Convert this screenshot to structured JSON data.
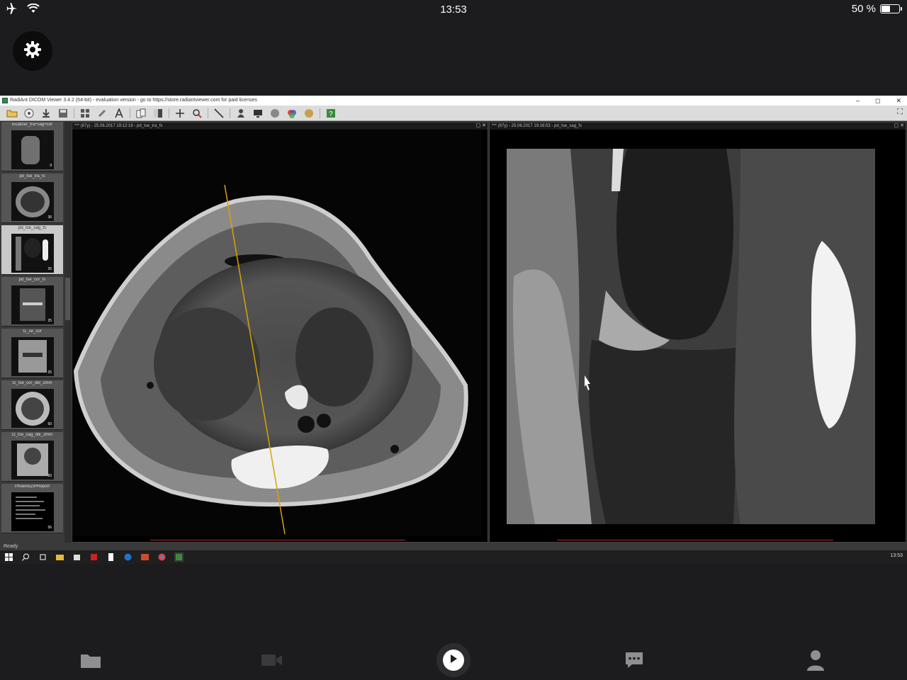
{
  "status_bar": {
    "time": "13:53",
    "battery_text": "50 %",
    "battery_level": 0.5
  },
  "remote": {
    "window_title": "RadiAnt DICOM Viewer 3.4.2 (64-bit) - evaluation version - go to https://store.radiantviewer.com for paid licenses",
    "window_controls": [
      "–",
      "◻",
      "✕"
    ],
    "status": "Ready",
    "taskbar_clock": "13:53",
    "series": [
      {
        "label": "localizer_tra+sag+cor",
        "count": "9"
      },
      {
        "label": "pd_tse_tra_fs",
        "count": "36"
      },
      {
        "label": "pd_tse_sag_fs",
        "count": "25"
      },
      {
        "label": "pd_tse_cor_fs",
        "count": "25"
      },
      {
        "label": "t1_se_cor",
        "count": "25"
      },
      {
        "label": "t2_tse_cor_obl_2mm",
        "count": "50"
      },
      {
        "label": "t2_tse_sag_obl_2mm",
        "count": "50"
      },
      {
        "label": "PhoenixZIPReport",
        "count": "56"
      }
    ],
    "viewport_left_header": "*** (87y) - 25.06.2017 19:12:19 - pd_tse_tra_fs",
    "viewport_right_header": "*** (87y) - 25.06.2017 19:16:53 - pd_tse_sag_fs",
    "viewport_buttons": "▢ ✕"
  }
}
